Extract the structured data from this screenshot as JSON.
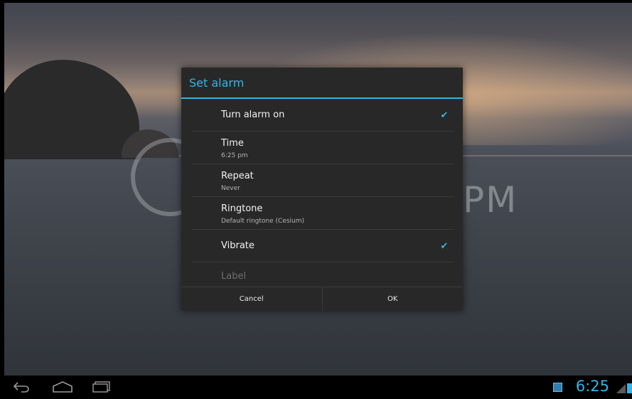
{
  "dialog": {
    "title": "Set alarm",
    "rows": [
      {
        "title": "Turn alarm on",
        "checked": true
      },
      {
        "title": "Time",
        "summary": "6:25 pm"
      },
      {
        "title": "Repeat",
        "summary": "Never"
      },
      {
        "title": "Ringtone",
        "summary": "Default ringtone (Cesium)"
      },
      {
        "title": "Vibrate",
        "checked": true
      },
      {
        "title": "Label"
      }
    ],
    "buttons": {
      "cancel": "Cancel",
      "ok": "OK"
    }
  },
  "background": {
    "clock_suffix": "PM"
  },
  "status_bar": {
    "time": "6:25"
  },
  "icons": {
    "checkbox": "checkbox-checked-icon",
    "nav": [
      "back-icon",
      "home-icon",
      "recent-apps-icon"
    ],
    "status": [
      "sync-icon",
      "signal-icon",
      "battery-icon"
    ]
  },
  "colors": {
    "accent": "#33b5e5",
    "dialog_bg": "#282828"
  }
}
